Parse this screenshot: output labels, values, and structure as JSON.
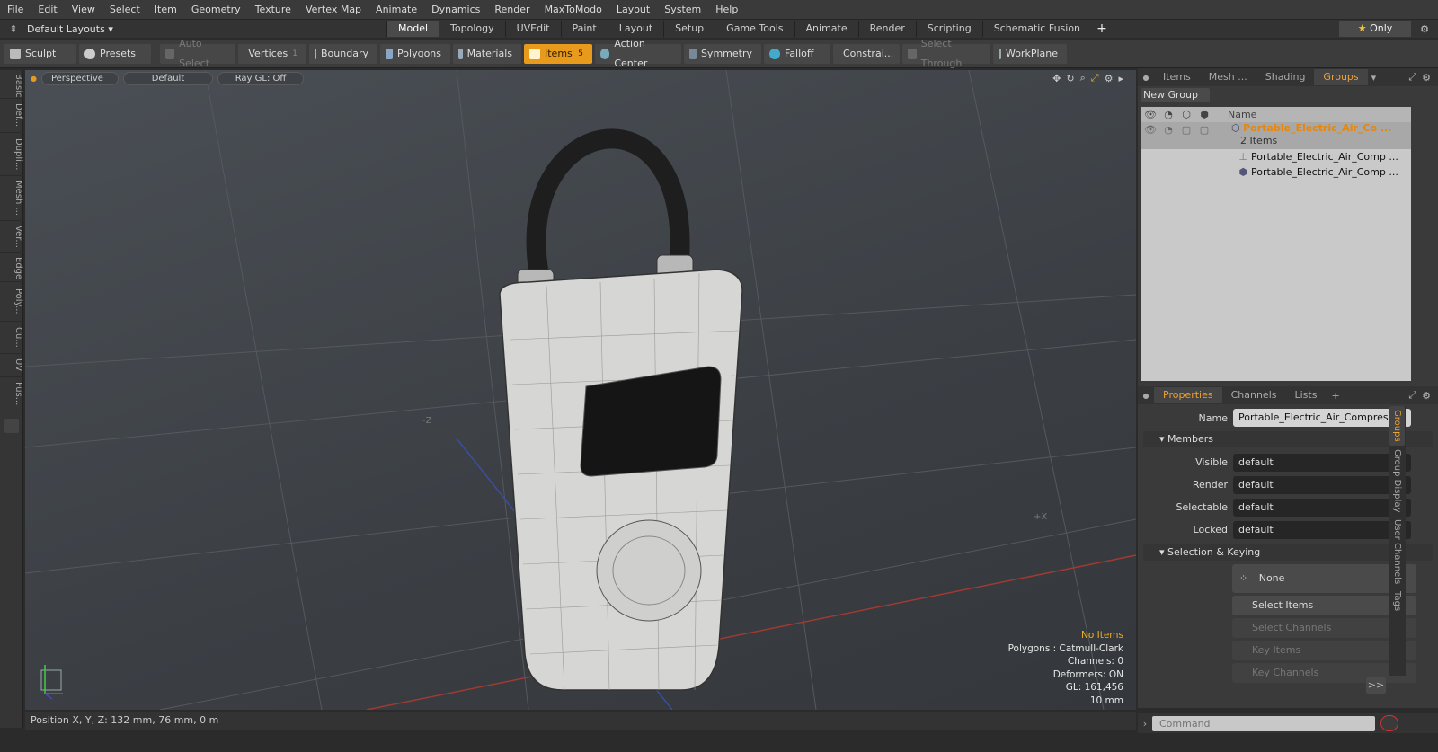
{
  "menu": [
    "File",
    "Edit",
    "View",
    "Select",
    "Item",
    "Geometry",
    "Texture",
    "Vertex Map",
    "Animate",
    "Dynamics",
    "Render",
    "MaxToModo",
    "Layout",
    "System",
    "Help"
  ],
  "layout_selector": "Default Layouts",
  "layout_tabs": [
    "Model",
    "Topology",
    "UVEdit",
    "Paint",
    "Layout",
    "Setup",
    "Game Tools",
    "Animate",
    "Render",
    "Scripting",
    "Schematic Fusion"
  ],
  "active_layout_tab": "Model",
  "only_label": "Only",
  "toolbar": {
    "sculpt": "Sculpt",
    "presets": "Presets",
    "auto_select": "Auto Select",
    "vertices": "Vertices",
    "vertices_count": "1",
    "boundary": "Boundary",
    "polygons": "Polygons",
    "materials": "Materials",
    "items": "Items",
    "items_count": "5",
    "action_center": "Action Center",
    "symmetry": "Symmetry",
    "falloff": "Falloff",
    "constraints": "Constrai...",
    "select_through": "Select Through",
    "workplane": "WorkPlane"
  },
  "left_tabs": [
    "Basic",
    "Def...",
    "Dupli...",
    "Mesh ...",
    "Ver...",
    "Edge",
    "Poly...",
    "Cu...",
    "UV",
    "Fus..."
  ],
  "viewport": {
    "view": "Perspective",
    "shading": "Default",
    "raygl": "Ray GL: Off",
    "axis_neg_z": "-Z",
    "axis_x": "+X",
    "stats": [
      "No Items",
      "Polygons : Catmull-Clark",
      "Channels: 0",
      "Deformers: ON",
      "GL: 161,456",
      "10 mm"
    ]
  },
  "status": "Position X, Y, Z:  132 mm, 76 mm, 0 m",
  "top_panel": {
    "tabs": [
      "Items",
      "Mesh ...",
      "Shading",
      "Groups"
    ],
    "active_tab": "Groups",
    "new_group": "New Group",
    "name_header": "Name",
    "group_name": "Portable_Electric_Air_Co ...",
    "group_count": "2 Items",
    "children": [
      "Portable_Electric_Air_Comp ...",
      "Portable_Electric_Air_Comp ..."
    ]
  },
  "properties": {
    "tabs": [
      "Properties",
      "Channels",
      "Lists"
    ],
    "name_label": "Name",
    "name_value": "Portable_Electric_Air_Compressor",
    "members": "Members",
    "fields": [
      {
        "label": "Visible",
        "value": "default"
      },
      {
        "label": "Render",
        "value": "default"
      },
      {
        "label": "Selectable",
        "value": "default"
      },
      {
        "label": "Locked",
        "value": "default"
      }
    ],
    "selection_keying": "Selection & Keying",
    "none": "None",
    "buttons": [
      "Select Items",
      "Select Channels",
      "Key Items",
      "Key Channels"
    ],
    "more": ">>",
    "side_tabs": [
      "Groups",
      "Group Display",
      "User Channels",
      "Tags"
    ]
  },
  "command_placeholder": "Command",
  "colors": {
    "accent": "#e89a1c",
    "group_text": "#e8860c"
  }
}
